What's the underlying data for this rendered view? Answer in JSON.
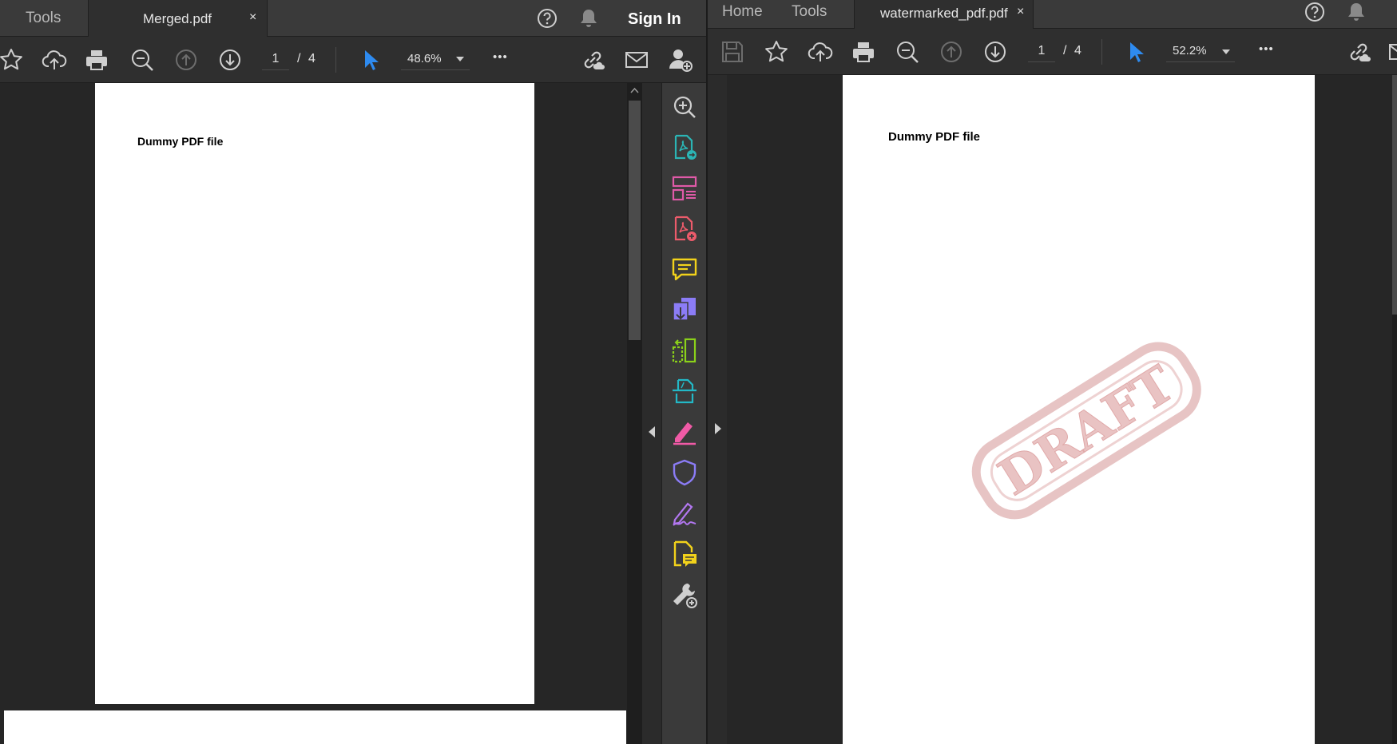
{
  "left_window": {
    "tabs": {
      "tools_label": "Tools",
      "document_name": "Merged.pdf",
      "close_glyph": "×"
    },
    "header": {
      "sign_in_label": "Sign In",
      "help_icon": "help-icon",
      "bell_icon": "bell-icon"
    },
    "toolbar": {
      "current_page": "1",
      "page_separator": "/",
      "total_pages": "4",
      "zoom": "48.6%",
      "more_glyph": "•••"
    },
    "document": {
      "heading": "Dummy PDF file"
    },
    "tools_pane": {
      "tools": [
        {
          "icon": "enhance-scan-icon",
          "color": "#cfcfcf"
        },
        {
          "icon": "export-pdf-icon",
          "color": "#2bb5b5"
        },
        {
          "icon": "organize-pages-icon",
          "color": "#e05aa8"
        },
        {
          "icon": "create-pdf-icon",
          "color": "#ec5b6b"
        },
        {
          "icon": "comment-icon",
          "color": "#f2d21b"
        },
        {
          "icon": "combine-files-icon",
          "color": "#8b7cf6"
        },
        {
          "icon": "compress-pdf-icon",
          "color": "#8bd11a"
        },
        {
          "icon": "scan-ocr-icon",
          "color": "#23b8c6"
        },
        {
          "icon": "fill-sign-icon",
          "color": "#f05aa6"
        },
        {
          "icon": "protect-icon",
          "color": "#8b7cf6"
        },
        {
          "icon": "request-signature-icon",
          "color": "#b277f0"
        },
        {
          "icon": "send-for-comments-icon",
          "color": "#f2d21b"
        },
        {
          "icon": "more-tools-icon",
          "color": "#cfcfcf"
        }
      ]
    }
  },
  "right_window": {
    "tabs": {
      "home_label": "Home",
      "tools_label": "Tools",
      "document_name": "watermarked_pdf.pdf",
      "close_glyph": "×"
    },
    "header": {
      "help_icon": "help-icon",
      "bell_icon": "bell-icon"
    },
    "toolbar": {
      "current_page": "1",
      "page_separator": "/",
      "total_pages": "4",
      "zoom": "52.2%",
      "more_glyph": "•••"
    },
    "document": {
      "heading": "Dummy PDF file",
      "watermark": "DRAFT"
    }
  },
  "colors": {
    "accent_cursor": "#2e8bf0",
    "watermark": "#e7b5b5"
  }
}
